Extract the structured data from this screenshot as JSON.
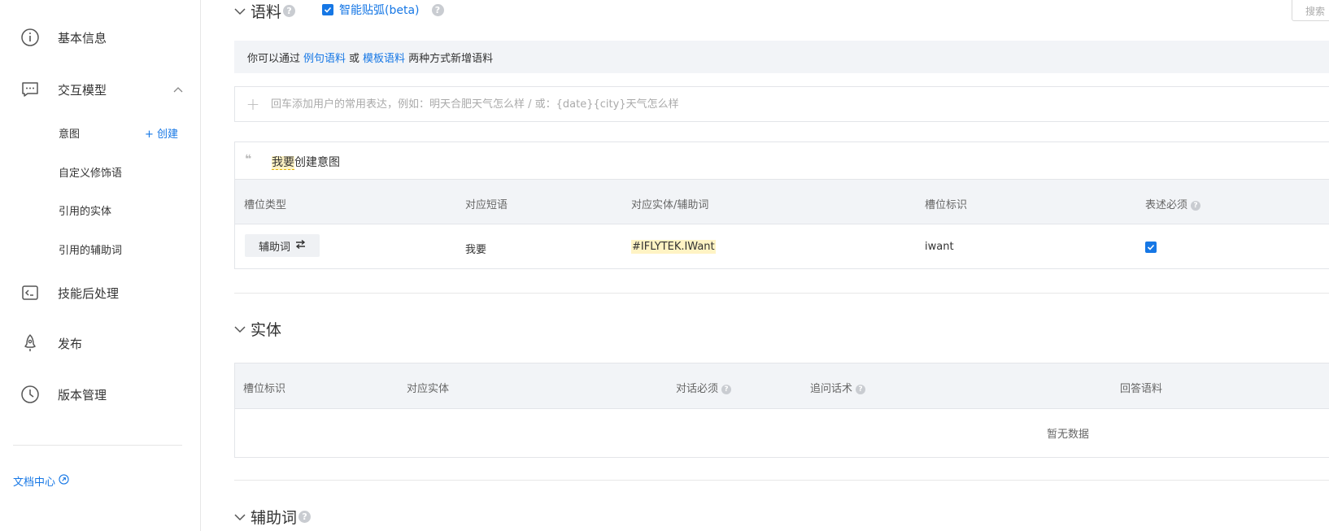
{
  "sidebar": {
    "items": [
      {
        "label": "基本信息",
        "icon": "info-icon"
      },
      {
        "label": "交互模型",
        "icon": "chat-icon"
      },
      {
        "label": "技能后处理",
        "icon": "terminal-icon"
      },
      {
        "label": "发布",
        "icon": "rocket-icon"
      },
      {
        "label": "版本管理",
        "icon": "clock-icon"
      }
    ],
    "sub_items": [
      "意图",
      "自定义修饰语",
      "引用的实体",
      "引用的辅助词"
    ],
    "create_label": "+ 创建",
    "doc_center": "文档中心"
  },
  "corpus": {
    "title": "语料",
    "smart_label": "智能贴弧(beta)",
    "search_placeholder": "搜索",
    "tip_prefix": "你可以通过",
    "tip_link1": "例句语料",
    "tip_or": "或",
    "tip_link2": "模板语料",
    "tip_suffix": "两种方式新增语料",
    "input_placeholder": "回车添加用户的常用表达，例如：明天合肥天气怎么样 / 或：{date}{city}天气怎么样",
    "example_highlight": "我要",
    "example_rest": "创建意图",
    "columns": [
      "槽位类型",
      "对应短语",
      "对应实体/辅助词",
      "槽位标识",
      "表述必须"
    ],
    "row": {
      "slot_type": "辅助词",
      "phrase": "我要",
      "entity": "#IFLYTEK.IWant",
      "slot_id": "iwant",
      "required": true
    }
  },
  "entity_section": {
    "title": "实体",
    "columns": [
      "槽位标识",
      "对应实体",
      "对话必须",
      "追问话术",
      "回答语料"
    ],
    "empty": "暂无数据"
  },
  "aux_section": {
    "title": "辅助词"
  },
  "colors": {
    "accent": "#1677e5",
    "highlight": "#fff3c4",
    "header_bg": "#f2f4f7"
  }
}
